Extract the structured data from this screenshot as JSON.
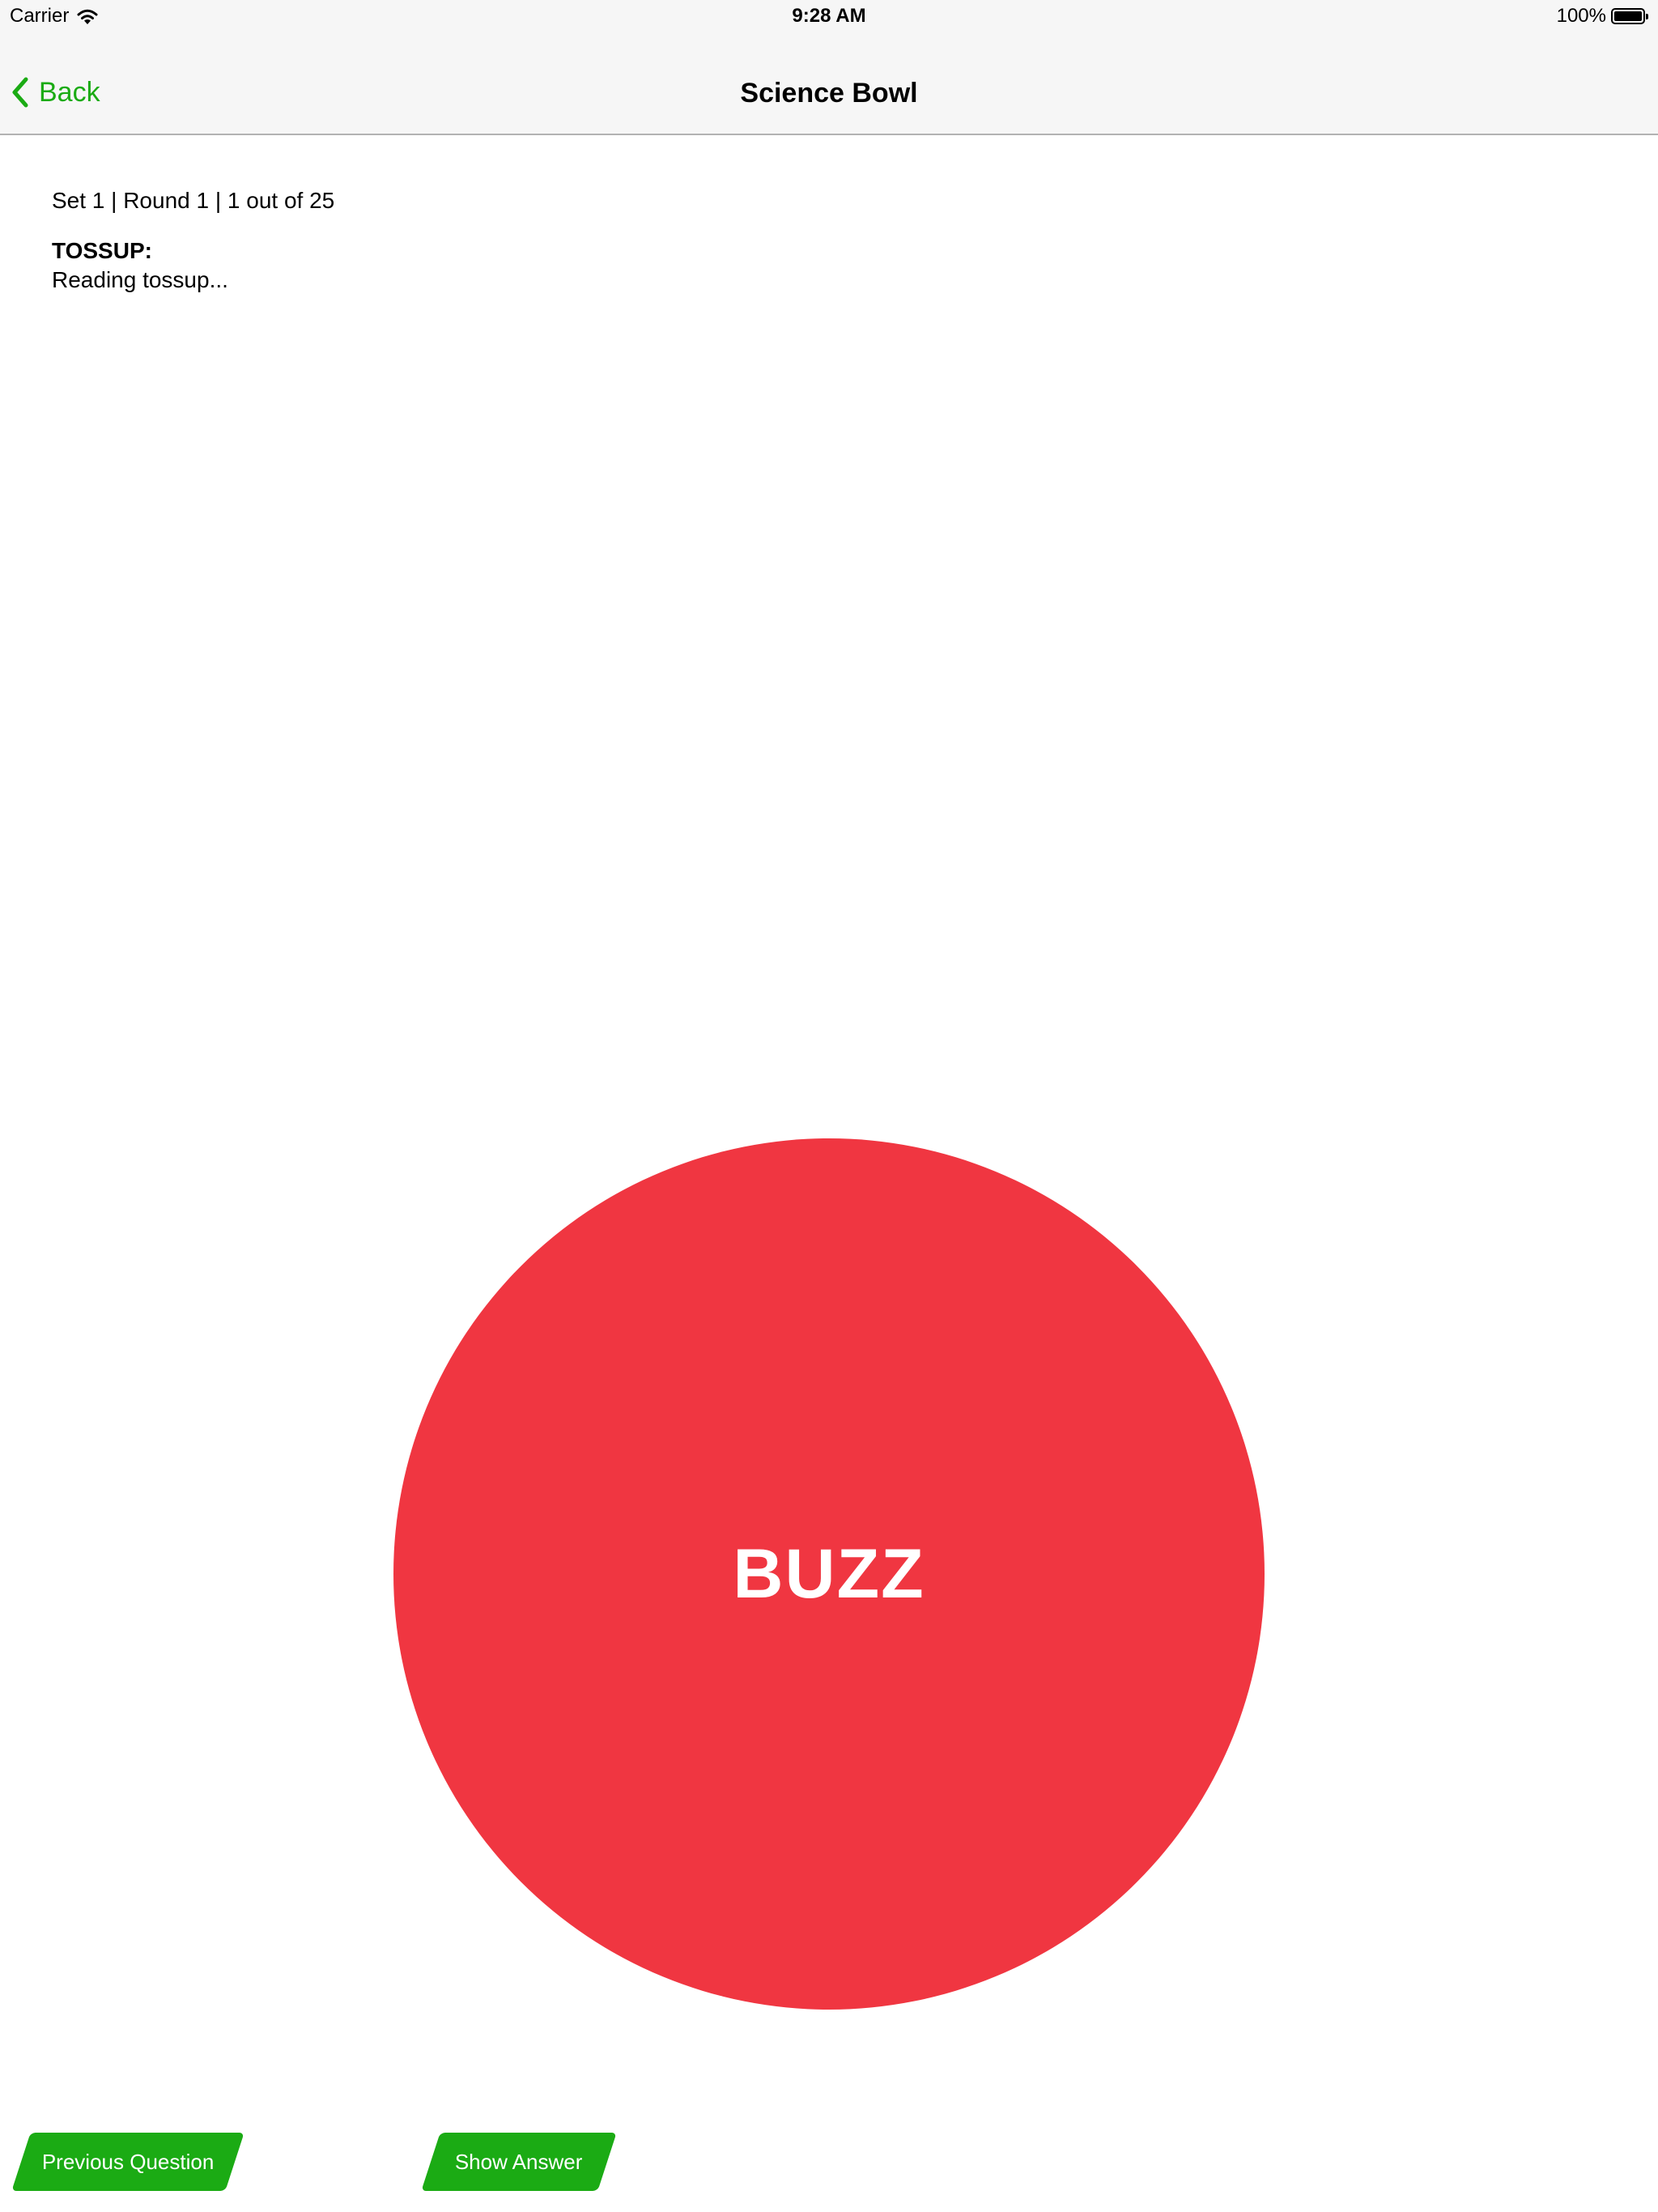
{
  "status_bar": {
    "carrier": "Carrier",
    "time": "9:28 AM",
    "battery_percent": "100%",
    "wifi_icon": "wifi-icon",
    "battery_icon": "battery-icon"
  },
  "nav": {
    "back_label": "Back",
    "back_icon": "chevron-left-icon",
    "title": "Science Bowl",
    "accent_color": "#1bab14"
  },
  "question": {
    "meta": "Set 1 | Round 1 | 1 out of 25",
    "type_label": "TOSSUP:",
    "status_text": "Reading tossup..."
  },
  "buzz": {
    "label": "BUZZ",
    "color": "#f03641"
  },
  "footer": {
    "previous_label": "Previous Question",
    "show_answer_label": "Show Answer",
    "button_color": "#1bab14"
  }
}
